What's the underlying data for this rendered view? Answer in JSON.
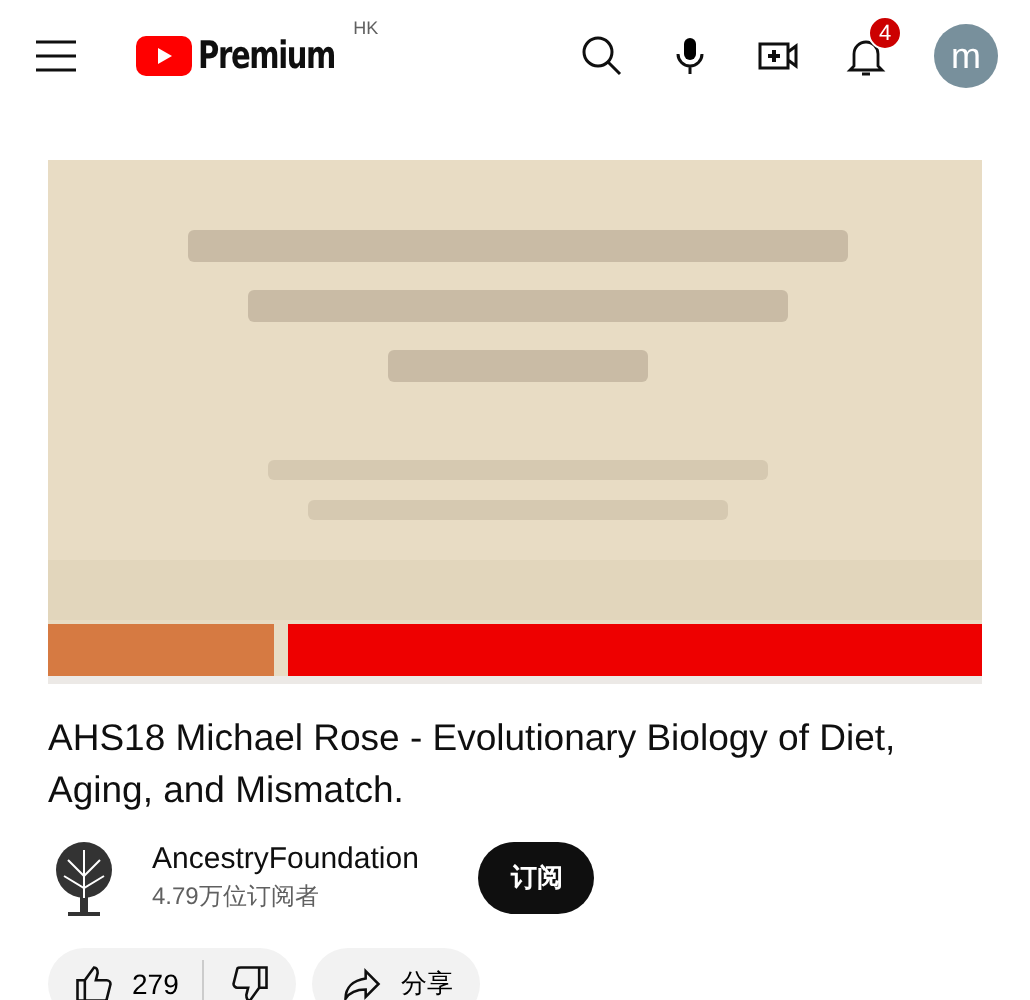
{
  "header": {
    "logo_text": "Premium",
    "region": "HK",
    "notification_count": "4",
    "avatar_letter": "m"
  },
  "title": "AHS18 Michael Rose - Evolutionary Biology of Diet, Aging, and Mismatch.",
  "channel": {
    "name": "AncestryFoundation",
    "subscribers": "4.79万位订阅者",
    "subscribe_button": "订阅"
  },
  "actions": {
    "likes": "279",
    "share": "分享"
  }
}
